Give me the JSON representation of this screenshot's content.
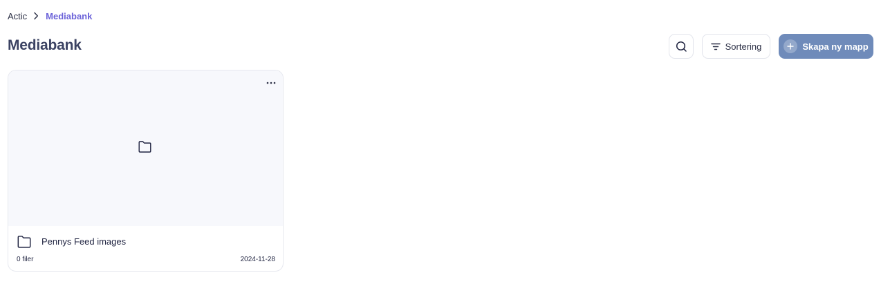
{
  "breadcrumb": {
    "root": "Actic",
    "current": "Mediabank"
  },
  "page": {
    "title": "Mediabank"
  },
  "toolbar": {
    "sort_label": "Sortering",
    "create_label": "Skapa ny mapp"
  },
  "folders": [
    {
      "name": "Pennys Feed images",
      "file_count": "0 filer",
      "date": "2024-11-28"
    }
  ],
  "colors": {
    "accent": "#6c63d9",
    "create_button": "#6f8bba",
    "title": "#3b4262",
    "preview_bg": "#f7f8fc"
  },
  "icons": {
    "breadcrumb_separator": "chevron-right-icon",
    "search": "search-icon",
    "sort": "filter-lines-icon",
    "create": "plus-circle-icon",
    "card_menu": "more-horizontal-icon",
    "folder": "folder-icon"
  }
}
